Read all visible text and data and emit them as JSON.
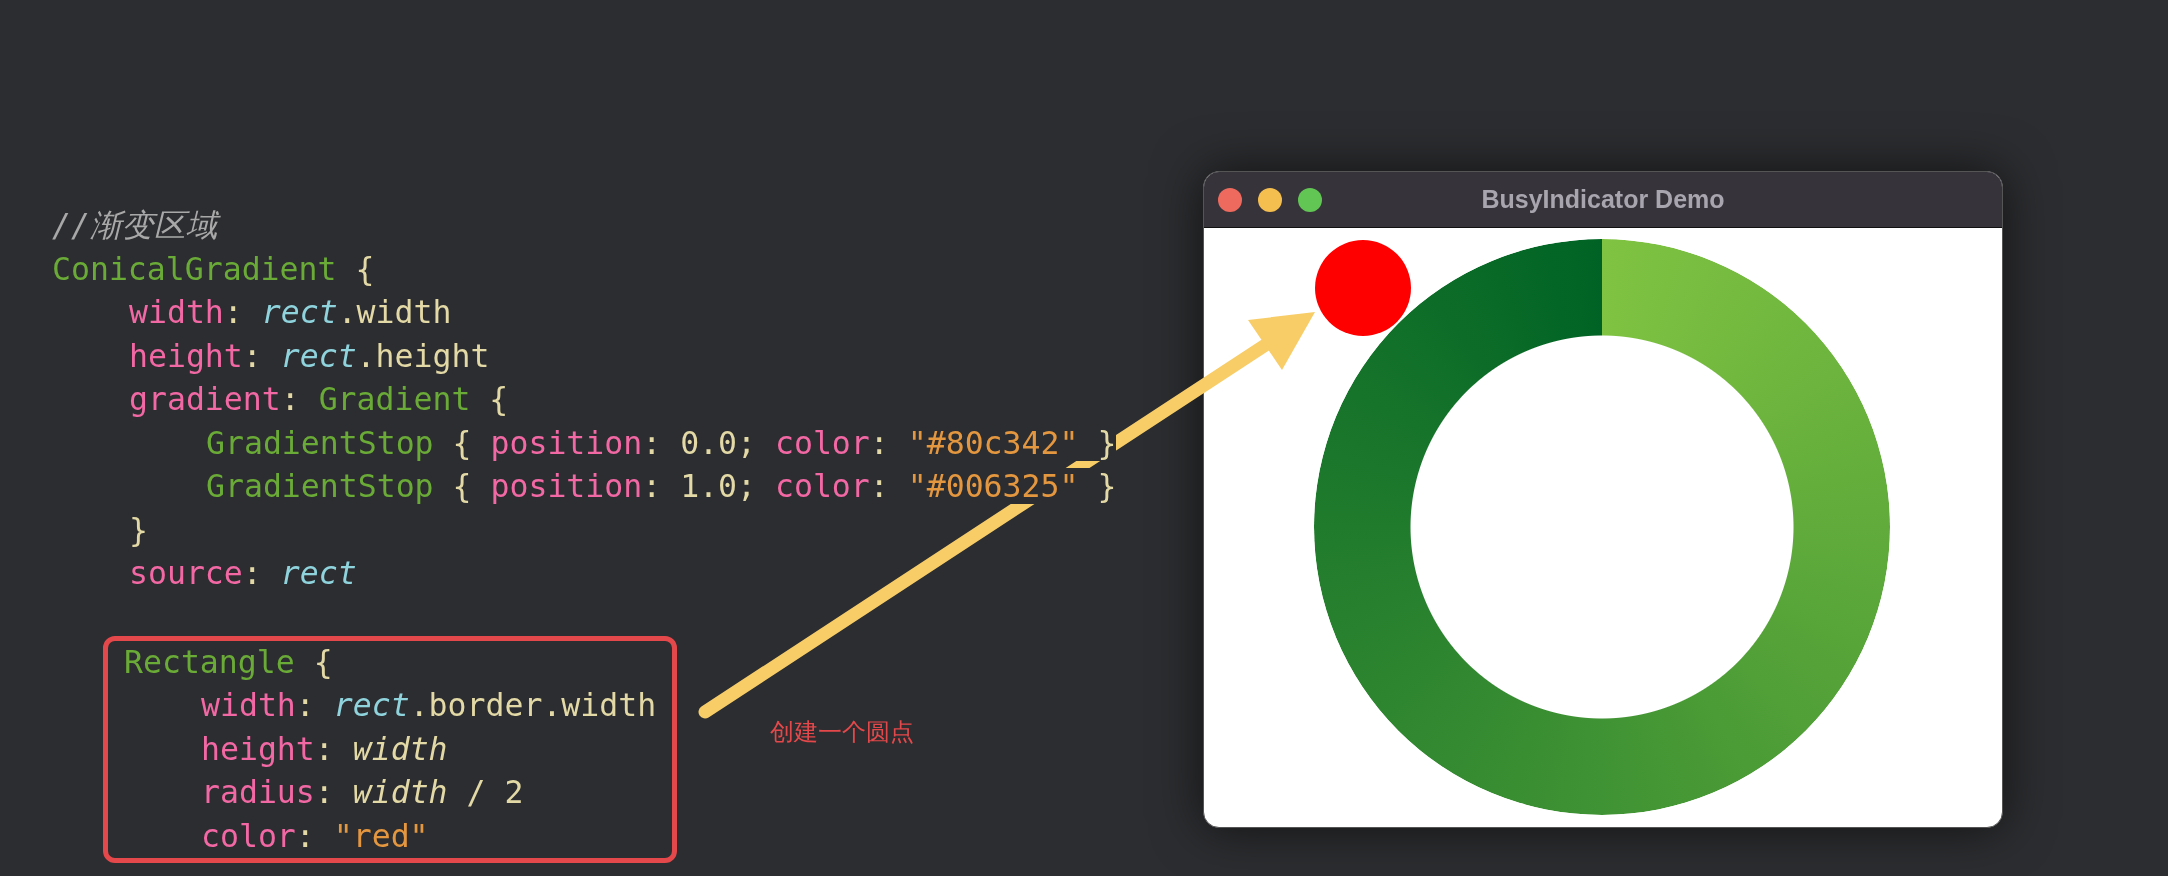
{
  "code": {
    "comment": "//渐变区域",
    "lines": [
      {
        "tokens": [
          {
            "text": "ConicalGradient",
            "kind": "type"
          },
          {
            "text": " {",
            "kind": "plain"
          }
        ],
        "children": [
          {
            "tokens": [
              {
                "text": "width",
                "kind": "prop"
              },
              {
                "text": ": ",
                "kind": "plain"
              },
              {
                "text": "rect",
                "kind": "ref"
              },
              {
                "text": ".width",
                "kind": "plain"
              }
            ]
          },
          {
            "tokens": [
              {
                "text": "height",
                "kind": "prop"
              },
              {
                "text": ": ",
                "kind": "plain"
              },
              {
                "text": "rect",
                "kind": "ref"
              },
              {
                "text": ".height",
                "kind": "plain"
              }
            ]
          },
          {
            "tokens": [
              {
                "text": "gradient",
                "kind": "prop"
              },
              {
                "text": ": ",
                "kind": "plain"
              },
              {
                "text": "Gradient",
                "kind": "type"
              },
              {
                "text": " {",
                "kind": "plain"
              }
            ],
            "children": [
              {
                "tokens": [
                  {
                    "text": "GradientStop",
                    "kind": "type"
                  },
                  {
                    "text": " { ",
                    "kind": "plain"
                  },
                  {
                    "text": "position",
                    "kind": "prop"
                  },
                  {
                    "text": ": 0.0; ",
                    "kind": "plain"
                  },
                  {
                    "text": "color",
                    "kind": "prop"
                  },
                  {
                    "text": ": ",
                    "kind": "plain"
                  },
                  {
                    "text": "\"#80c342\"",
                    "kind": "string"
                  },
                  {
                    "text": " }",
                    "kind": "plain"
                  }
                ]
              },
              {
                "tokens": [
                  {
                    "text": "GradientStop",
                    "kind": "type"
                  },
                  {
                    "text": " { ",
                    "kind": "plain"
                  },
                  {
                    "text": "position",
                    "kind": "prop"
                  },
                  {
                    "text": ": 1.0; ",
                    "kind": "plain"
                  },
                  {
                    "text": "color",
                    "kind": "prop"
                  },
                  {
                    "text": ": ",
                    "kind": "plain"
                  },
                  {
                    "text": "\"#006325\"",
                    "kind": "string"
                  },
                  {
                    "text": " }",
                    "kind": "plain"
                  }
                ]
              }
            ]
          },
          {
            "tokens": [
              {
                "text": "}",
                "kind": "plain"
              }
            ]
          },
          {
            "tokens": [
              {
                "text": "source",
                "kind": "prop"
              },
              {
                "text": ": ",
                "kind": "plain"
              },
              {
                "text": "rect",
                "kind": "ref"
              }
            ]
          },
          {
            "boxed": true,
            "tokens": [
              {
                "text": "Rectangle",
                "kind": "type"
              },
              {
                "text": " {",
                "kind": "plain"
              }
            ],
            "children": [
              {
                "tokens": [
                  {
                    "text": "width",
                    "kind": "prop"
                  },
                  {
                    "text": ": ",
                    "kind": "plain"
                  },
                  {
                    "text": "rect",
                    "kind": "ref"
                  },
                  {
                    "text": ".border.width",
                    "kind": "plain"
                  }
                ]
              },
              {
                "tokens": [
                  {
                    "text": "height",
                    "kind": "prop"
                  },
                  {
                    "text": ": ",
                    "kind": "plain"
                  },
                  {
                    "text": "width",
                    "kind": "value"
                  }
                ]
              },
              {
                "tokens": [
                  {
                    "text": "radius",
                    "kind": "prop"
                  },
                  {
                    "text": ": ",
                    "kind": "plain"
                  },
                  {
                    "text": "width",
                    "kind": "value"
                  },
                  {
                    "text": " / 2",
                    "kind": "plain"
                  }
                ]
              },
              {
                "tokens": [
                  {
                    "text": "color",
                    "kind": "prop"
                  },
                  {
                    "text": ": ",
                    "kind": "plain"
                  },
                  {
                    "text": "\"red\"",
                    "kind": "string"
                  }
                ]
              }
            ]
          }
        ]
      }
    ]
  },
  "annotation": {
    "label": "创建一个圆点"
  },
  "window": {
    "title": "BusyIndicator Demo"
  }
}
